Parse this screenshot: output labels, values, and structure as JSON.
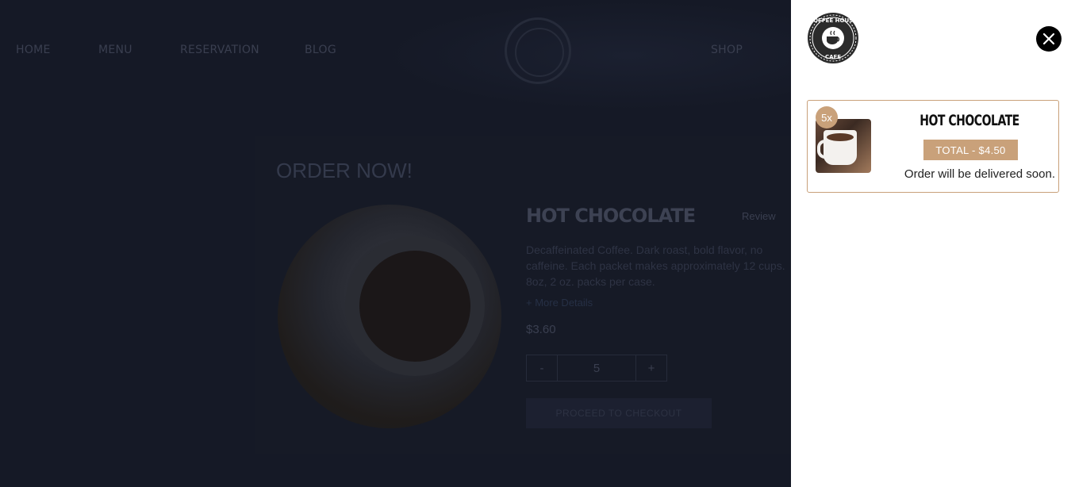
{
  "nav": {
    "items": [
      "HOME",
      "MENU",
      "RESERVATION",
      "BLOG",
      "SHOP"
    ]
  },
  "order": {
    "heading": "ORDER NOW!",
    "product_name": "HOT CHOCOLATE",
    "review_label": "Review",
    "description": "Decaffeinated Coffee. Dark roast, bold flavor, no caffeine. Each packet makes approximately 12 cups. 8oz, 2 oz. packs per case.",
    "more_link": "+ More Details",
    "price": "$3.60",
    "quantity": "5",
    "minus_label": "-",
    "plus_label": "+",
    "button_label": "PROCEED TO CHECKOUT"
  },
  "cart": {
    "logo_text_top": "COFFEE HOUSE",
    "logo_text_bottom": "CAFE",
    "item": {
      "quantity_badge": "5x",
      "name": "HOT CHOCOLATE",
      "total": "TOTAL - $4.50",
      "delivery_note": "Order will be delivered soon."
    },
    "close_icon": "close-icon"
  },
  "colors": {
    "accent": "#c9a17a",
    "panel_bg": "#ffffff",
    "backdrop": "#151926"
  }
}
